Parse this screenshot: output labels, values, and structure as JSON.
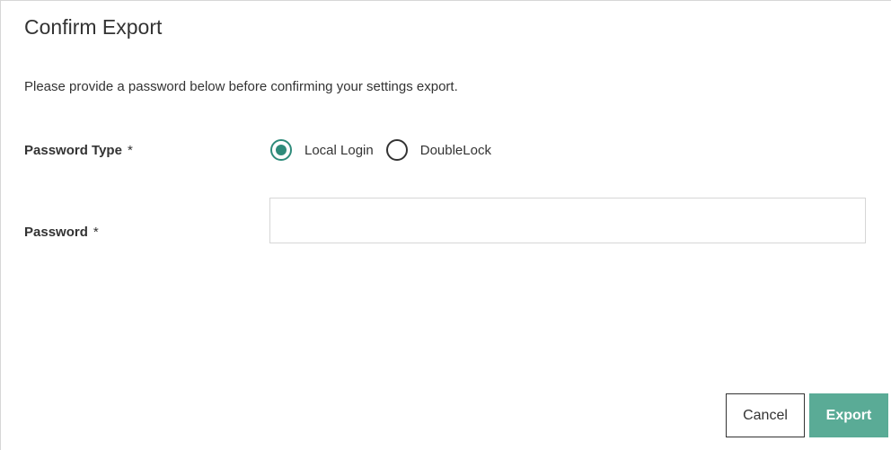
{
  "dialog": {
    "title": "Confirm Export",
    "description": "Please provide a password below before confirming your settings export."
  },
  "form": {
    "password_type": {
      "label": "Password Type",
      "required_mark": "*",
      "options": [
        {
          "label": "Local Login",
          "selected": true
        },
        {
          "label": "DoubleLock",
          "selected": false
        }
      ]
    },
    "password": {
      "label": "Password",
      "required_mark": "*",
      "value": "",
      "placeholder": ""
    }
  },
  "actions": {
    "cancel_label": "Cancel",
    "export_label": "Export"
  },
  "colors": {
    "accent": "#2e8b7a",
    "export_button": "#5aab96",
    "text": "#333333",
    "border": "#d6d6d6"
  },
  "icons": {
    "radio_selected": "radio-selected-icon",
    "radio_unselected": "radio-unselected-icon"
  }
}
